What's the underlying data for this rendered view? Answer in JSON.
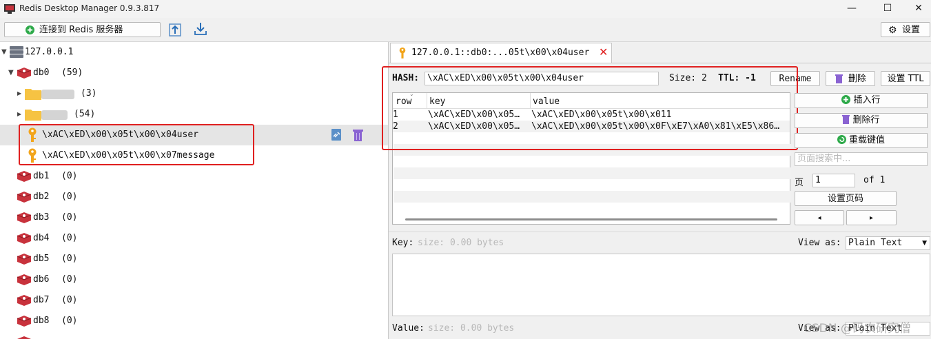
{
  "window": {
    "title": "Redis Desktop Manager 0.9.3.817",
    "minimize": "—",
    "maximize": "☐",
    "close": "✕"
  },
  "toolbar": {
    "connect_label": "连接到 Redis 服务器",
    "settings_label": "设置"
  },
  "tree": {
    "server": "127.0.0.1",
    "databases": [
      {
        "name": "db0",
        "count": "(59)"
      },
      {
        "name": "db1",
        "count": "(0)"
      },
      {
        "name": "db2",
        "count": "(0)"
      },
      {
        "name": "db3",
        "count": "(0)"
      },
      {
        "name": "db4",
        "count": "(0)"
      },
      {
        "name": "db5",
        "count": "(0)"
      },
      {
        "name": "db6",
        "count": "(0)"
      },
      {
        "name": "db7",
        "count": "(0)"
      },
      {
        "name": "db8",
        "count": "(0)"
      }
    ],
    "folders": [
      {
        "count": "(3)"
      },
      {
        "count": "(54)"
      }
    ],
    "keys": [
      "\\xAC\\xED\\x00\\x05t\\x00\\x04user",
      "\\xAC\\xED\\x00\\x05t\\x00\\x07message"
    ]
  },
  "tab": {
    "label": "127.0.0.1::db0:...05t\\x00\\x04user"
  },
  "key_view": {
    "type_label": "HASH:",
    "key_name": "\\xAC\\xED\\x00\\x05t\\x00\\x04user",
    "size_label": "Size: 2",
    "ttl_label": "TTL: -1",
    "rename": "Rename",
    "delete": "删除",
    "set_ttl": "设置 TTL"
  },
  "table": {
    "headers": [
      "row",
      "key",
      "value"
    ],
    "rows": [
      [
        "1",
        "\\xAC\\xED\\x00\\x05…",
        "\\xAC\\xED\\x00\\x05t\\x00\\x011"
      ],
      [
        "2",
        "\\xAC\\xED\\x00\\x05…",
        "\\xAC\\xED\\x00\\x05t\\x00\\x0F\\xE7\\xA0\\x81\\xE5\\x86…"
      ]
    ]
  },
  "side_actions": {
    "insert_row": "插入行",
    "delete_row": "删除行",
    "reload": "重载键值",
    "search_placeholder": "页面搜索中...",
    "page_label": "页",
    "page_value": "1",
    "of_label": "of 1",
    "set_page": "设置页码",
    "prev": "◂",
    "next": "▸"
  },
  "editor": {
    "key_label": "Key:",
    "key_size": "size: 0.00 bytes",
    "value_label": "Value:",
    "value_size": "size: 0.00 bytes",
    "view_as_label": "View as:",
    "view_as_value": "Plain Text"
  },
  "watermark": "CSDN @码农研究僧",
  "colors": {
    "accent_red": "#e02020",
    "db_red": "#c8323c",
    "key_orange": "#f2a51c",
    "folder_yellow": "#f6c343",
    "green_icon": "#2eaa4a",
    "purple_icon": "#8a63d2"
  }
}
